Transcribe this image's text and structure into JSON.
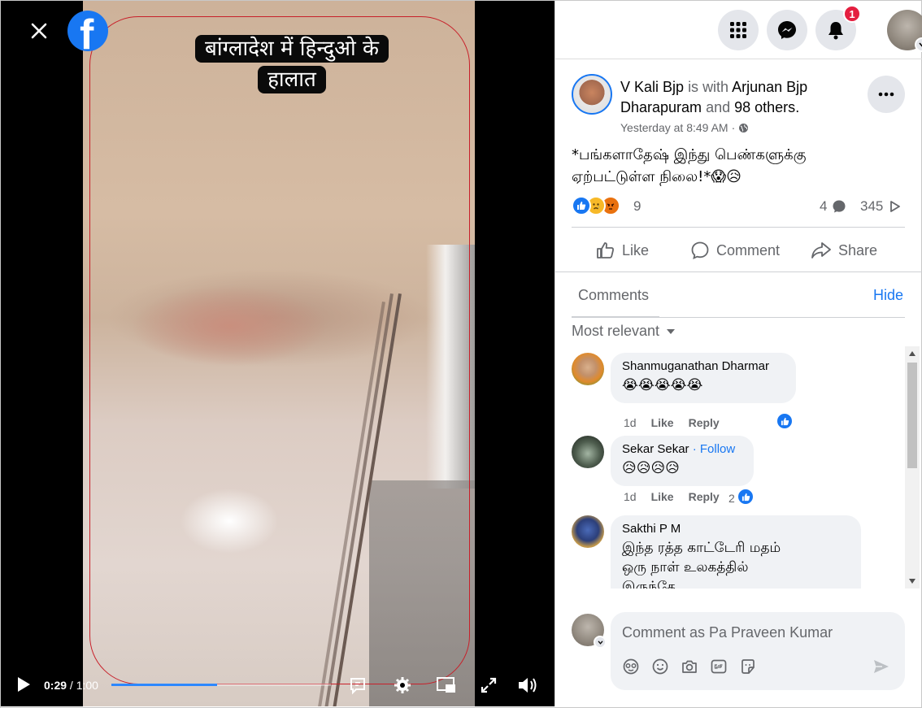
{
  "video": {
    "caption_line1": "बांग्लादेश में हिन्दुओ के",
    "caption_line2": "हालात",
    "time_current": "0:29",
    "time_total": "/ 1:00",
    "progress": 0.48
  },
  "notifications": {
    "count": "1"
  },
  "post": {
    "author": "V Kali Bjp",
    "with_text": "is with",
    "tagged": "Arjunan Bjp Dharapuram",
    "and_text": "and",
    "others": "98 others",
    "period": ".",
    "time": "Yesterday at 8:49 AM",
    "separator": "·",
    "text_line1": "*பங்களாதேஷ் இந்து பெண்களுக்கு",
    "text_line2": "ஏற்பட்டுள்ள நிலை!*😱😥",
    "reactions_count": "9",
    "comments_count": "4",
    "views_count": "345"
  },
  "actions": {
    "like": "Like",
    "comment": "Comment",
    "share": "Share"
  },
  "comments_section": {
    "tab_label": "Comments",
    "hide_label": "Hide",
    "sort_label": "Most relevant"
  },
  "comments": [
    {
      "author": "Shanmuganathan Dharmar",
      "text": "😭😭😭😭😭",
      "age": "1d",
      "like": "Like",
      "reply": "Reply",
      "likes": ""
    },
    {
      "author": "Sekar Sekar",
      "follow": "· Follow",
      "text": "😥😥😥😥",
      "age": "1d",
      "like": "Like",
      "reply": "Reply",
      "likes": "2"
    },
    {
      "author": "Sakthi P M",
      "text_line1": "இந்த ரத்த காட்டேரி மதம்",
      "text_line2": "ஒரு நாள் உலகத்தில்",
      "text_line3": "இருந்தே"
    }
  ],
  "composer": {
    "placeholder": "Comment as Pa Praveen Kumar"
  },
  "colors": {
    "brand": "#1877f2",
    "badge": "#e41e3f",
    "outline": "#c8202a"
  }
}
